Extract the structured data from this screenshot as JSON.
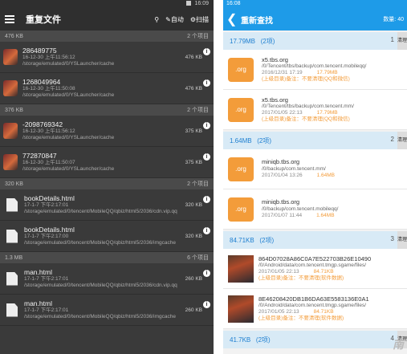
{
  "left": {
    "status_time": "16:09",
    "title": "重复文件",
    "toolbar": {
      "auto_label": "自动",
      "scan_label": "扫描"
    },
    "groups": [
      {
        "size": "476 KB",
        "count": "2 个项目",
        "type": "image",
        "items": [
          {
            "name": "286489775",
            "date": "16-12-30 上午11:56:12",
            "path": "/storage/emulated/0/YSLauncher/cache",
            "size": "476 KB"
          },
          {
            "name": "1268049964",
            "date": "16-12-30 上午11:50:08",
            "path": "/storage/emulated/0/YSLauncher/cache",
            "size": "476 KB"
          }
        ]
      },
      {
        "size": "376 KB",
        "count": "2 个项目",
        "type": "image",
        "items": [
          {
            "name": "-2098769342",
            "date": "16-12-30 上午11:56:12",
            "path": "/storage/emulated/0/YSLauncher/cache",
            "size": "375 KB"
          },
          {
            "name": "772870847",
            "date": "16-12-30 上午11:50:07",
            "path": "/storage/emulated/0/YSLauncher/cache",
            "size": "375 KB"
          }
        ]
      },
      {
        "size": "320 KB",
        "count": "2 个项目",
        "type": "file",
        "items": [
          {
            "name": "bookDetails.html",
            "date": "17-1-7 下午2:17:01",
            "path": "/storage/emulated/0/tencent/MobileQQ/qbiz/html5/2036/cdn.vip.qq",
            "size": "320 KB"
          },
          {
            "name": "bookDetails.html",
            "date": "17-1-7 下午2:17:00",
            "path": "/storage/emulated/0/tencent/MobileQQ/qbiz/html5/2036/imgcache",
            "size": "320 KB"
          }
        ]
      },
      {
        "size": "1.3 MB",
        "count": "6 个项目",
        "type": "file",
        "items": [
          {
            "name": "man.html",
            "date": "17-1-7 下午2:17:01",
            "path": "/storage/emulated/0/tencent/MobileQQ/qbiz/html5/2036/cdn.vip.qq",
            "size": "260 KB"
          },
          {
            "name": "man.html",
            "date": "17-1-7 下午2:17:01",
            "path": "/storage/emulated/0/tencent/MobileQQ/qbiz/html5/2036/imgcache",
            "size": "260 KB"
          }
        ]
      }
    ]
  },
  "right": {
    "status_time": "16:08",
    "title": "重新查找",
    "count_label": "数量: 40",
    "groups": [
      {
        "size": "17.79MB",
        "count": "(2项)",
        "num": "1",
        "action": "清理",
        "icon": "org",
        "items": [
          {
            "name": "x5.tbs.org",
            "path": "/0/Tencent/tbs/backup/com.tencent.mobileqq/",
            "date": "2016/12/31 17:19",
            "size": "17.79MB",
            "note": "(上级目录)备注：不要清理(QQ和微信)"
          },
          {
            "name": "x5.tbs.org",
            "path": "/0/Tencent/tbs/backup/com.tencent.mm/",
            "date": "2017/01/05 22:13",
            "size": "17.79MB",
            "note": "(上级目录)备注：不要清理(QQ和微信)"
          }
        ]
      },
      {
        "size": "1.64MB",
        "count": "(2项)",
        "num": "2",
        "action": "清理",
        "icon": "org",
        "items": [
          {
            "name": "miniqb.tbs.org",
            "path": "/0/backup/com.tencent.mm/",
            "date": "2017/01/04 13:26",
            "size": "1.64MB",
            "note": ""
          },
          {
            "name": "miniqb.tbs.org",
            "path": "/0/backup/com.tencent.mobileqq/",
            "date": "2017/01/07 11:44",
            "size": "1.64MB",
            "note": ""
          }
        ]
      },
      {
        "size": "84.71KB",
        "count": "(2项)",
        "num": "3",
        "action": "清理",
        "icon": "game",
        "items": [
          {
            "name": "864D07028A86C0A7E522703B26E10490",
            "path": "/0/Android/data/com.tencent.tmgp.sgame/files/",
            "date": "2017/01/05 22:13",
            "size": "84.71KB",
            "note": "(上级目录)备注：不要清理(软件数据)"
          },
          {
            "name": "8E46208420DB1B6DA63E5583136E0A1",
            "path": "/0/Android/data/com.tencent.tmgp.sgame/files/",
            "date": "2017/01/05 22:13",
            "size": "84.71KB",
            "note": "(上级目录)备注：不要清理(软件数据)"
          }
        ]
      },
      {
        "size": "41.7KB",
        "count": "(2项)",
        "num": "4",
        "action": "清理",
        "icon": "org",
        "items": []
      }
    ]
  }
}
